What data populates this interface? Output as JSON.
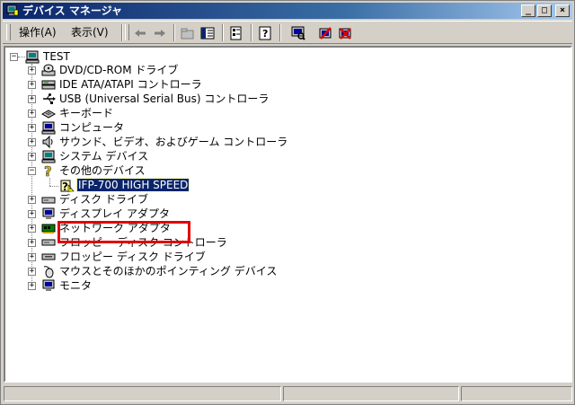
{
  "window": {
    "title": "デバイス マネージャ"
  },
  "title_buttons": {
    "minimize": "_",
    "maximize": "□",
    "close": "×"
  },
  "menu": {
    "action": "操作(A)",
    "view": "表示(V)"
  },
  "tree": {
    "root": "TEST",
    "categories": [
      {
        "label": "DVD/CD-ROM ドライブ",
        "icon": "cdrom-icon"
      },
      {
        "label": "IDE ATA/ATAPI コントローラ",
        "icon": "ide-controller-icon"
      },
      {
        "label": "USB (Universal Serial Bus) コントローラ",
        "icon": "usb-icon"
      },
      {
        "label": "キーボード",
        "icon": "keyboard-icon"
      },
      {
        "label": "コンピュータ",
        "icon": "computer-icon"
      },
      {
        "label": "サウンド、ビデオ、およびゲーム コントローラ",
        "icon": "sound-icon"
      },
      {
        "label": "システム デバイス",
        "icon": "system-icon"
      },
      {
        "label": "その他のデバイス",
        "icon": "unknown-device-icon"
      },
      {
        "label": "ディスク ドライブ",
        "icon": "disk-icon"
      },
      {
        "label": "ディスプレイ アダプタ",
        "icon": "display-icon"
      },
      {
        "label": "ネットワーク アダプタ",
        "icon": "network-icon"
      },
      {
        "label": "フロッピー ディスク コントローラ",
        "icon": "floppy-controller-icon"
      },
      {
        "label": "フロッピー ディスク ドライブ",
        "icon": "floppy-icon"
      },
      {
        "label": "マウスとそのほかのポインティング デバイス",
        "icon": "mouse-icon"
      },
      {
        "label": "モニタ",
        "icon": "monitor-icon"
      }
    ],
    "child": {
      "label": "IFP-700 HIGH SPEED",
      "icon": "unknown-device-warning-icon"
    }
  },
  "colors": {
    "titlebar": "#0a246a",
    "selection": "#0a246a",
    "highlight_box": "#e00000",
    "face": "#d4d0c8"
  }
}
